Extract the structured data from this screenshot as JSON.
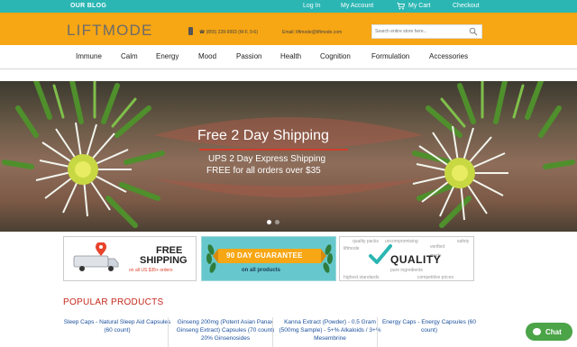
{
  "topbar": {
    "blog": "OUR BLOG",
    "login": "Log In",
    "account": "My Account",
    "cart": "My Cart",
    "checkout": "Checkout"
  },
  "header": {
    "logo": "LIFTMODE",
    "phone": "☎ (855) 228-9993 (M-F, 9-6)",
    "email": "Email: liftmode@liftmode.com",
    "search_placeholder": "Search entire store here..."
  },
  "nav": {
    "items": [
      "Immune",
      "Calm",
      "Energy",
      "Mood",
      "Passion",
      "Health",
      "Cognition",
      "Formulation",
      "Accessories"
    ]
  },
  "hero": {
    "title": "Free 2 Day Shipping",
    "line1": "UPS 2 Day Express Shipping",
    "line2": "FREE for all orders over $35",
    "active_slide": 1
  },
  "promos": {
    "shipping": {
      "line1": "FREE",
      "line2": "SHIPPING",
      "small": "on all US $35+ orders"
    },
    "guarantee": {
      "ribbon": "90 DAY GUARANTEE",
      "sub": "on all products"
    },
    "quality": {
      "title": "QUALITY",
      "words": [
        "uncompromising",
        "verified",
        "liftmode",
        "safety",
        "pure ingredients",
        "highest standards",
        "competitive prices",
        "quality packs",
        "made"
      ]
    }
  },
  "popular": {
    "heading": "POPULAR PRODUCTS",
    "products": [
      "Sleep Caps - Natural Sleep Aid Capsules (60 count)",
      "Ginseng 200mg (Potent Asian Panax Ginseng Extract) Capsules (70 count) 20% Ginsenosides",
      "Kanna Extract (Powder) - 0.5 Gram (500mg Sample) - 5+% Alkaloids / 3+% Mesembrine",
      "Energy Caps - Energy Capsules (60 count)"
    ]
  },
  "chat": {
    "label": "Chat"
  },
  "colors": {
    "teal": "#2bb6b3",
    "orange": "#f7a614",
    "red": "#c4281c",
    "link": "#1a4f9c",
    "chat": "#4ba448"
  }
}
